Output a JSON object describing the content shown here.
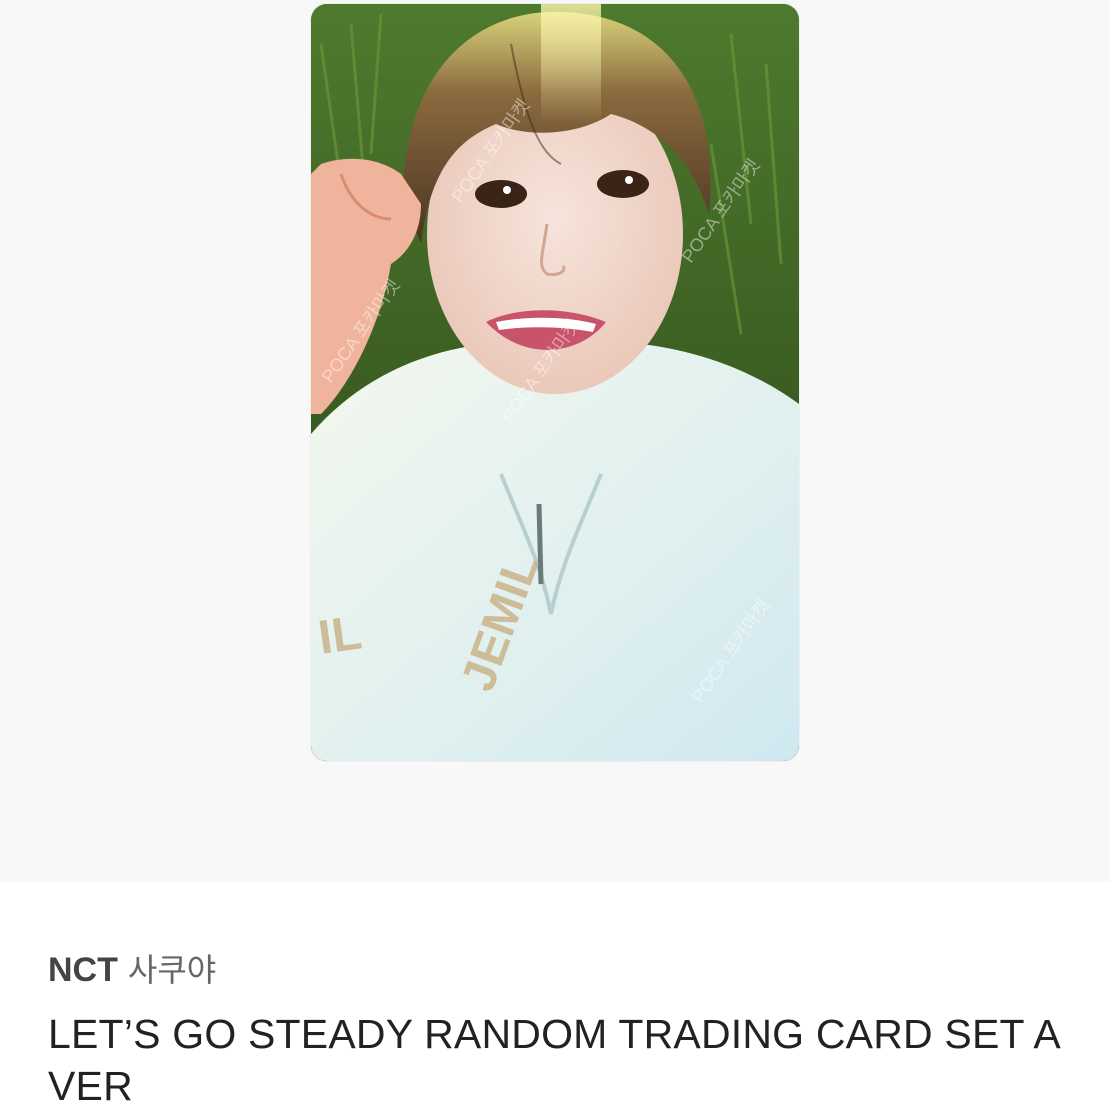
{
  "product": {
    "image_alt": "NCT 사쿠야 photocard",
    "watermark": "POCA 포카마켓",
    "group": "NCT",
    "member": "사쿠야",
    "title": "LET’S GO STEADY RANDOM TRADING CARD SET A VER"
  },
  "colors": {
    "image_background": "#f8f8f8",
    "text_primary": "#222222",
    "text_secondary": "#555555"
  }
}
